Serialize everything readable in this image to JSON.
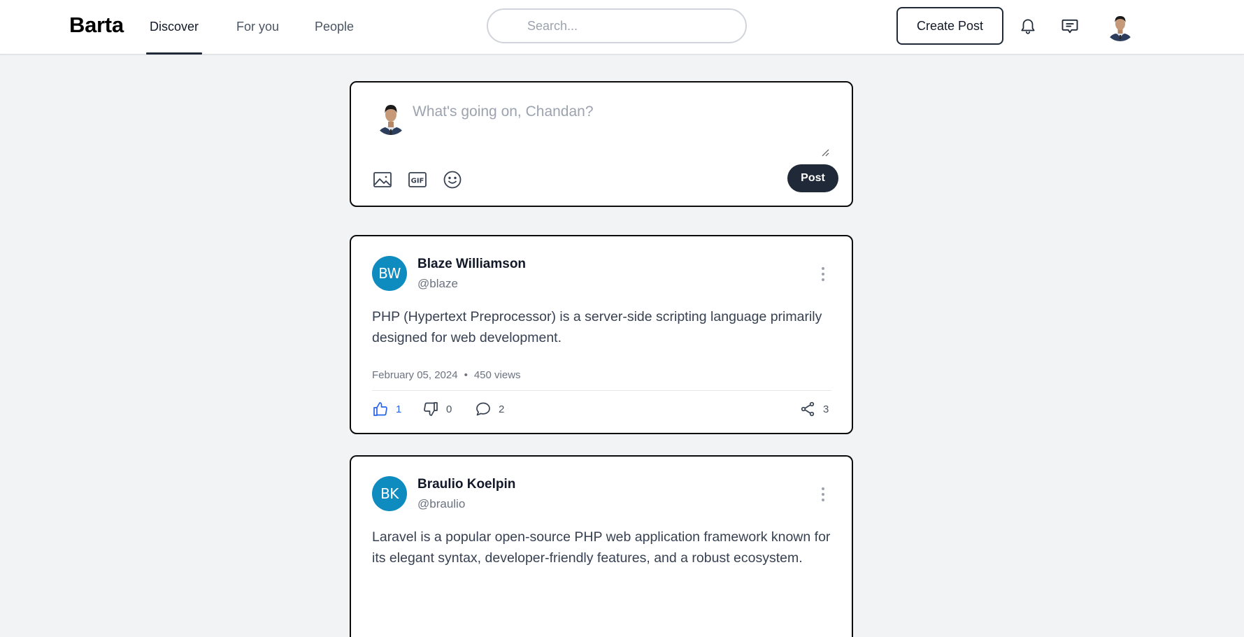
{
  "header": {
    "logo": "Barta",
    "nav": [
      {
        "label": "Discover",
        "active": true
      },
      {
        "label": "For you",
        "active": false
      },
      {
        "label": "People",
        "active": false
      }
    ],
    "search": {
      "placeholder": "Search...",
      "value": ""
    },
    "create_post_label": "Create Post",
    "icons": [
      "bell-icon",
      "chat-icon"
    ],
    "user_avatar": "user-avatar-photo"
  },
  "composer": {
    "placeholder": "What's going on, Chandan?",
    "value": "",
    "tools": [
      "image-icon",
      "gif-icon",
      "emoji-icon"
    ],
    "post_label": "Post"
  },
  "posts": [
    {
      "initials": "BW",
      "avatar_color": "#0e8bbf",
      "name": "Blaze Williamson",
      "handle": "@blaze",
      "body": "PHP (Hypertext Preprocessor) is a server-side scripting language primarily designed for web development.",
      "date": "February 05, 2024",
      "separator": "•",
      "views": "450 views",
      "likes": "1",
      "dislikes": "0",
      "comments": "2",
      "shares": "3",
      "liked_color": "#2563eb"
    },
    {
      "initials": "BK",
      "avatar_color": "#0e8bbf",
      "name": "Braulio Koelpin",
      "handle": "@braulio",
      "body": "Laravel is a popular open-source PHP web application framework known for its elegant syntax, developer-friendly features, and a robust ecosystem."
    }
  ]
}
